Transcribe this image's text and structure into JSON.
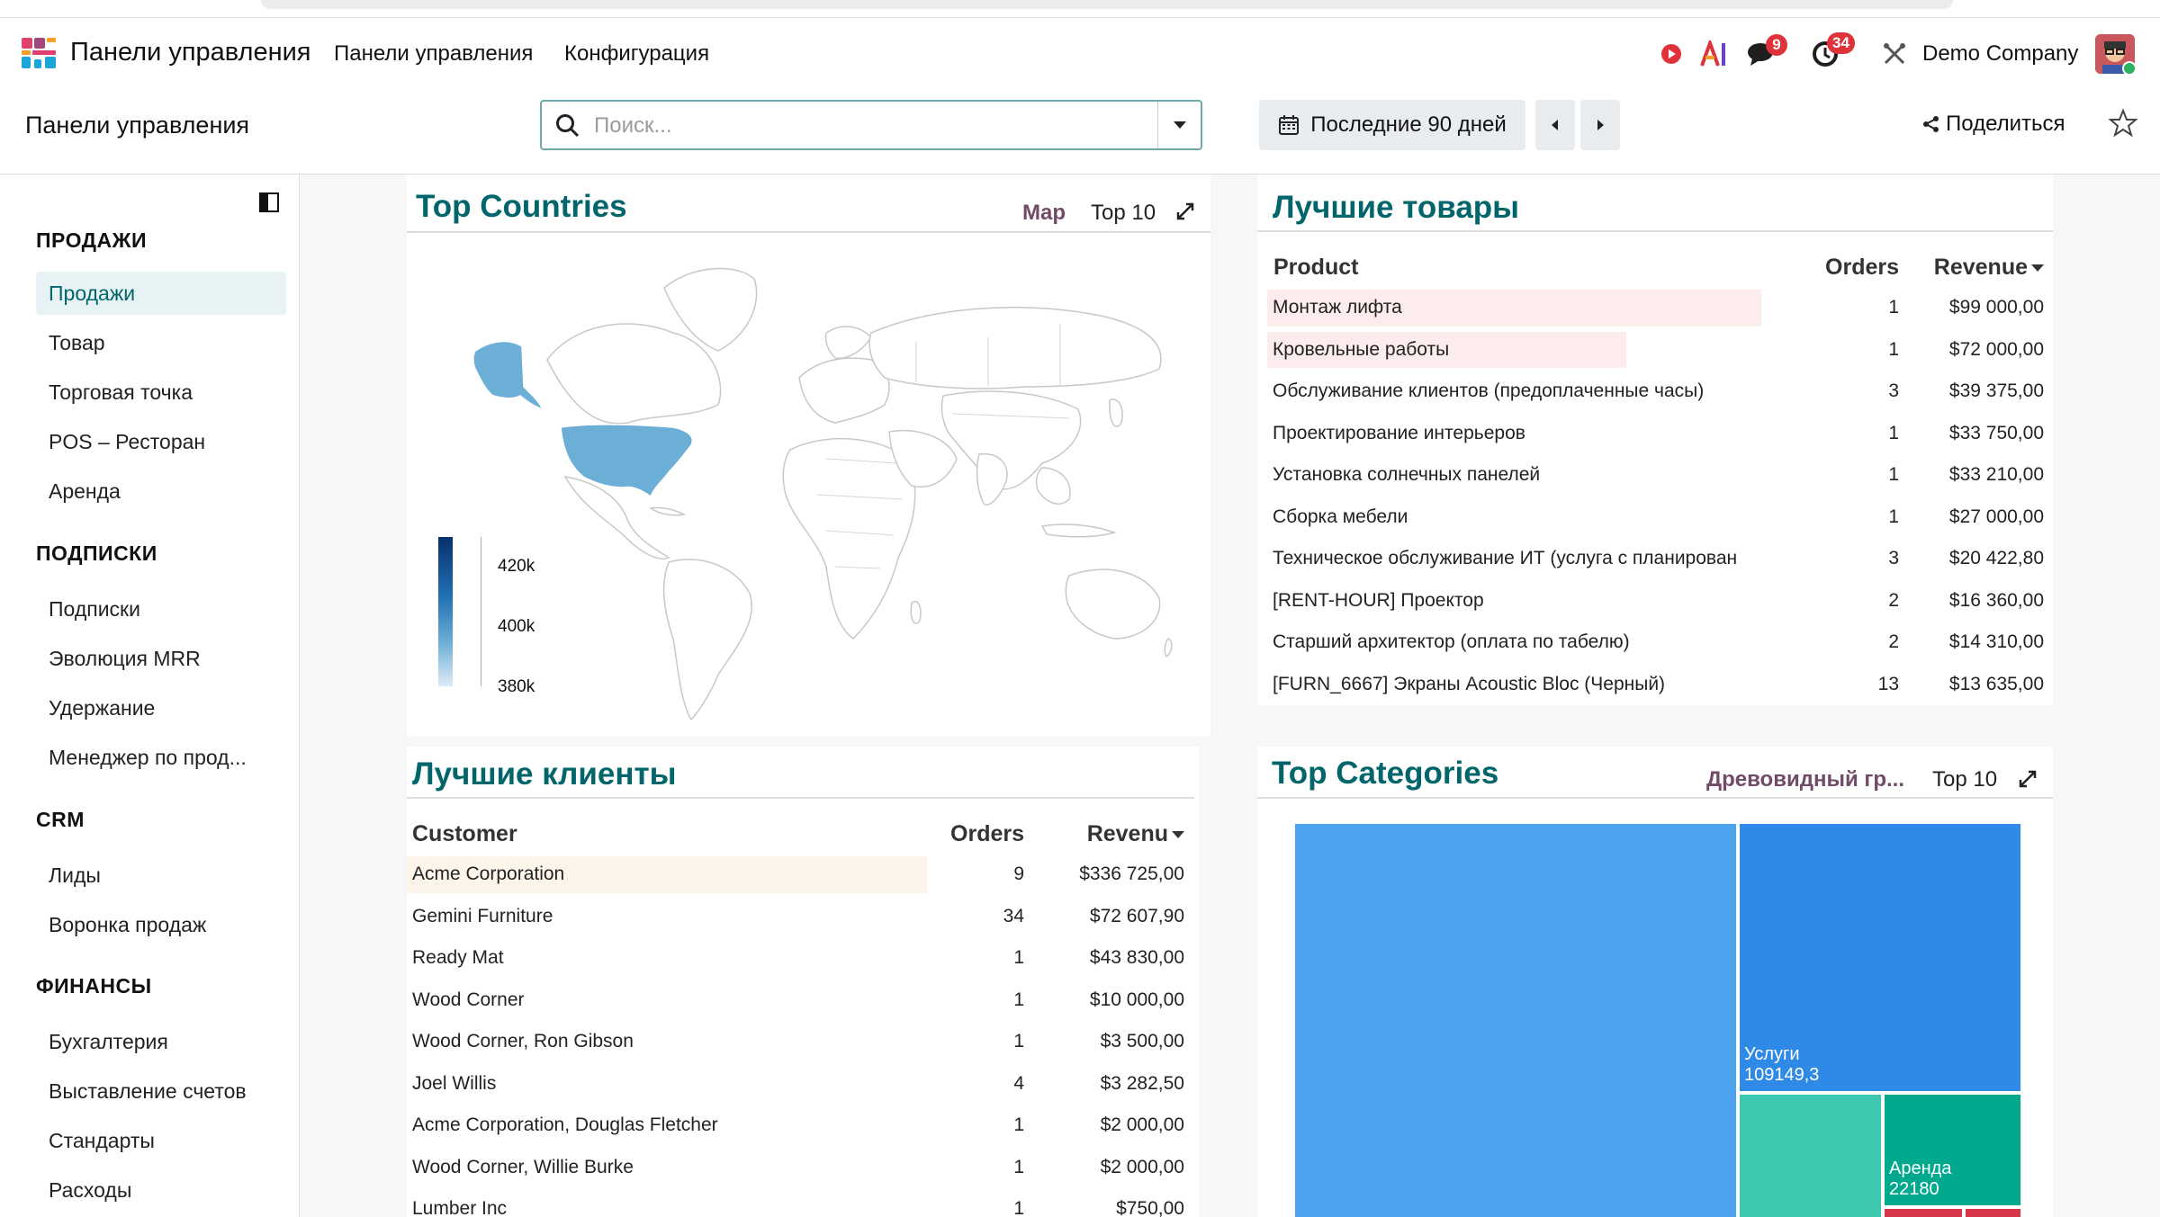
{
  "navbar": {
    "app_title": "Панели управления",
    "menus": [
      "Панели управления",
      "Конфигурация"
    ],
    "messages_count": "9",
    "activities_count": "34",
    "company": "Demo Company"
  },
  "control": {
    "breadcrumb": "Панели управления",
    "search_placeholder": "Поиск...",
    "period_label": "Последние 90 дней",
    "share_label": "Поделиться"
  },
  "sidebar": {
    "sections": [
      {
        "title": "ПРОДАЖИ",
        "items": [
          "Продажи",
          "Товар",
          "Торговая точка",
          "POS – Ресторан",
          "Аренда"
        ]
      },
      {
        "title": "ПОДПИСКИ",
        "items": [
          "Подписки",
          "Эволюция MRR",
          "Удержание",
          "Менеджер по прод..."
        ]
      },
      {
        "title": "CRM",
        "items": [
          "Лиды",
          "Воронка продаж"
        ]
      },
      {
        "title": "ФИНАНСЫ",
        "items": [
          "Бухгалтерия",
          "Выставление счетов",
          "Стандарты",
          "Расходы"
        ]
      }
    ],
    "active_item": "Продажи"
  },
  "top_countries": {
    "title": "Top Countries",
    "tool_map": "Map",
    "tool_top": "Top 10",
    "legend_ticks": [
      "420k",
      "400k",
      "380k"
    ],
    "highlight_color": "#6baed6"
  },
  "best_products": {
    "title": "Лучшие товары",
    "headers": {
      "product": "Product",
      "orders": "Orders",
      "revenue": "Revenue"
    },
    "rows": [
      {
        "name": "Монтаж лифта",
        "orders": "1",
        "revenue": "$99 000,00",
        "share": 1.0
      },
      {
        "name": "Кровельные работы",
        "orders": "1",
        "revenue": "$72 000,00",
        "share": 0.727
      },
      {
        "name": "Обслуживание клиентов (предоплаченные часы)",
        "orders": "3",
        "revenue": "$39 375,00",
        "share": 0.0
      },
      {
        "name": "Проектирование интерьеров",
        "orders": "1",
        "revenue": "$33 750,00",
        "share": 0.0
      },
      {
        "name": "Установка солнечных панелей",
        "orders": "1",
        "revenue": "$33 210,00",
        "share": 0.0
      },
      {
        "name": "Сборка мебели",
        "orders": "1",
        "revenue": "$27 000,00",
        "share": 0.0
      },
      {
        "name": "Техническое обслуживание ИТ (услуга с планирован",
        "orders": "3",
        "revenue": "$20 422,80",
        "share": 0.0
      },
      {
        "name": "[RENT-HOUR] Проектор",
        "orders": "2",
        "revenue": "$16 360,00",
        "share": 0.0
      },
      {
        "name": "Старший архитектор (оплата по табелю)",
        "orders": "2",
        "revenue": "$14 310,00",
        "share": 0.0
      },
      {
        "name": "[FURN_6667] Экраны Acoustic Bloc (Черный)",
        "orders": "13",
        "revenue": "$13 635,00",
        "share": 0.0
      }
    ],
    "bar_color": "#fdecec"
  },
  "best_customers": {
    "title": "Лучшие клиенты",
    "headers": {
      "customer": "Customer",
      "orders": "Orders",
      "revenue": "Revenu"
    },
    "rows": [
      {
        "name": "Acme Corporation",
        "orders": "9",
        "revenue": "$336 725,00",
        "share": 1.0
      },
      {
        "name": "Gemini Furniture",
        "orders": "34",
        "revenue": "$72 607,90",
        "share": 0.0
      },
      {
        "name": "Ready Mat",
        "orders": "1",
        "revenue": "$43 830,00",
        "share": 0.0
      },
      {
        "name": "Wood Corner",
        "orders": "1",
        "revenue": "$10 000,00",
        "share": 0.0
      },
      {
        "name": "Wood Corner, Ron Gibson",
        "orders": "1",
        "revenue": "$3 500,00",
        "share": 0.0
      },
      {
        "name": "Joel Willis",
        "orders": "4",
        "revenue": "$3 282,50",
        "share": 0.0
      },
      {
        "name": "Acme Corporation, Douglas Fletcher",
        "orders": "1",
        "revenue": "$2 000,00",
        "share": 0.0
      },
      {
        "name": "Wood Corner, Willie Burke",
        "orders": "1",
        "revenue": "$2 000,00",
        "share": 0.0
      },
      {
        "name": "Lumber Inc",
        "orders": "1",
        "revenue": "$750,00",
        "share": 0.0
      }
    ],
    "bar_color": "#fdf4ea"
  },
  "top_categories": {
    "title": "Top Categories",
    "tool_tree": "Древовидный гр...",
    "tool_top": "Top 10",
    "tiles": [
      {
        "label": "",
        "value": "",
        "color": "#4da3ef"
      },
      {
        "label": "Услуги",
        "value": "109149,3",
        "color": "#2e8ae6"
      },
      {
        "label": "",
        "value": "",
        "color": "#3fc8b0"
      },
      {
        "label": "Аренда",
        "value": "22180",
        "color": "#00a88e"
      },
      {
        "label": "",
        "value": "",
        "color": "#d8374a"
      }
    ]
  }
}
